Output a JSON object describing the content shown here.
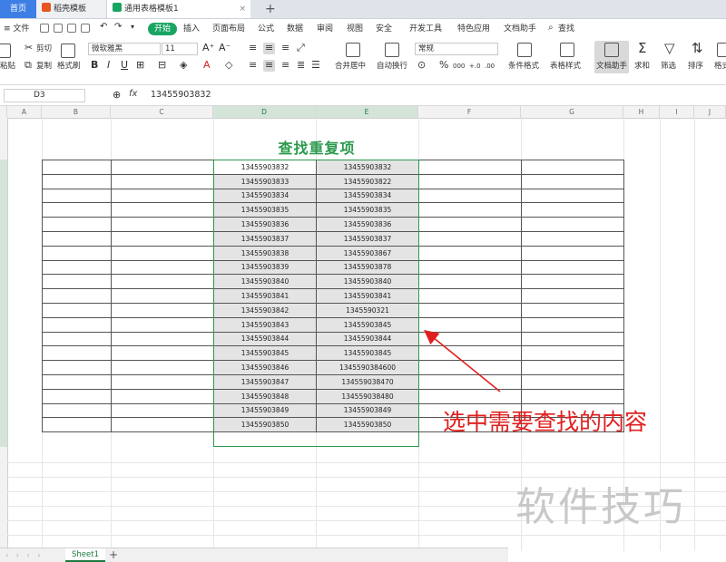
{
  "tabs": {
    "home": "首页",
    "daoke": "稻壳模板",
    "active": "通用表格模板1",
    "add": "+",
    "close": "×"
  },
  "menu": {
    "file": "≡ 文件",
    "items": [
      "开始",
      "插入",
      "页面布局",
      "公式",
      "数据",
      "审阅",
      "视图",
      "安全",
      "开发工具",
      "特色应用",
      "文档助手",
      "查找"
    ]
  },
  "ribbon": {
    "paste": "粘贴",
    "cut": "剪切",
    "copy": "复制",
    "format_painter": "格式刷",
    "font_name": "微软雅黑",
    "font_size": "11",
    "merge": "合并居中",
    "wrap": "自动换行",
    "number_format": "常规",
    "conditional": "条件格式",
    "table_style": "表格样式",
    "doc_helper": "文档助手",
    "sum": "求和",
    "filter": "筛选",
    "sort": "排序",
    "format": "格式",
    "percent": "%",
    "thousand": "000",
    "inc_dec": "+.0",
    "dec_dec": ".00"
  },
  "formula_bar": {
    "cell_ref": "D3",
    "fx": "fx",
    "value": "13455903832"
  },
  "columns": [
    "A",
    "B",
    "C",
    "D",
    "E",
    "F",
    "G",
    "H",
    "I",
    "J"
  ],
  "sheet": {
    "title": "查找重复项",
    "col_d": [
      "13455903832",
      "13455903833",
      "13455903834",
      "13455903835",
      "13455903836",
      "13455903837",
      "13455903838",
      "13455903839",
      "13455903840",
      "13455903841",
      "13455903842",
      "13455903843",
      "13455903844",
      "13455903845",
      "13455903846",
      "13455903847",
      "13455903848",
      "13455903849",
      "13455903850"
    ],
    "col_e": [
      "13455903832",
      "13455903822",
      "13455903834",
      "13455903835",
      "13455903836",
      "13455903837",
      "13455903867",
      "13455903878",
      "13455903840",
      "13455903841",
      "1345590321",
      "13455903845",
      "13455903844",
      "13455903845",
      "1345590384600",
      "134559038470",
      "134559038480",
      "13455903849",
      "13455903850"
    ]
  },
  "annotation": "选中需要查找的内容",
  "watermark": "软件技巧",
  "sheet_tabs": {
    "sheet1": "Sheet1",
    "add": "+",
    "nav": "‹ › ‹ ›"
  },
  "colors": {
    "accent_green": "#2a9a4c",
    "annotation_red": "#e02020",
    "home_tab_blue": "#3d7fe4"
  }
}
